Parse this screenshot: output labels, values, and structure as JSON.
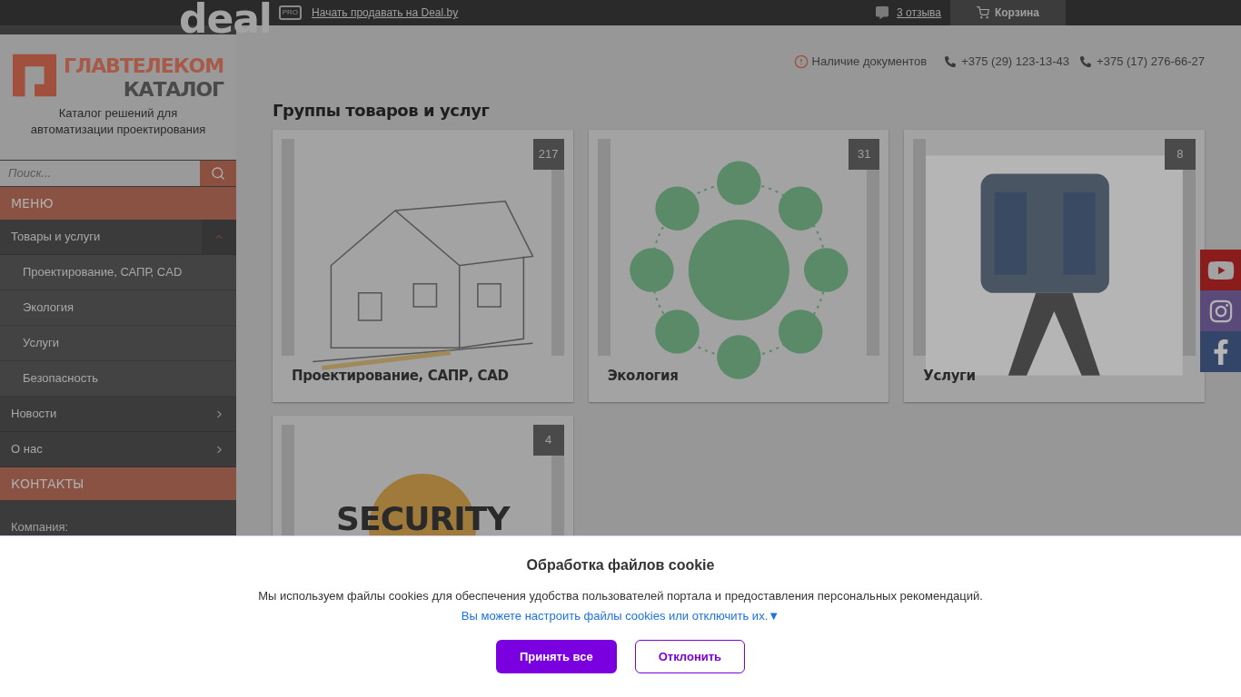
{
  "topbar": {
    "logo": "deal",
    "badge": "PRO",
    "sell_link": "Начать продавать на Deal.by",
    "reviews": "3 отзыва",
    "cart": "Корзина"
  },
  "sidebar": {
    "brand": "ГЛАВТЕЛЕКОМ",
    "brand_sub": "КАТАЛОГ",
    "tagline": "Каталог решений для автоматизации проектирования",
    "search": {
      "placeholder": "Поиск..."
    },
    "menu_title": "МЕНЮ",
    "menu": [
      {
        "label": "Товары и услуги",
        "expanded": true,
        "children": [
          {
            "label": "Проектирование, САПР, CAD"
          },
          {
            "label": "Экология"
          },
          {
            "label": "Услуги"
          },
          {
            "label": "Безопасность"
          }
        ]
      },
      {
        "label": "Новости",
        "expanded": false
      },
      {
        "label": "О нас",
        "expanded": false
      }
    ],
    "contacts_title": "КОНТАКТЫ",
    "contacts": [
      "Компания:"
    ]
  },
  "header_info": [
    {
      "kind": "warning",
      "text": "Наличие документов"
    },
    {
      "kind": "phone",
      "text": "+375 (29) 123-13-43"
    },
    {
      "kind": "phone",
      "text": "+375 (17) 276-66-27"
    }
  ],
  "section_title": "Группы товаров и услуг",
  "cards": [
    {
      "title": "Проектирование, САПР, CAD",
      "count": "217"
    },
    {
      "title": "Экология",
      "count": "31"
    },
    {
      "title": "Услуги",
      "count": "8"
    },
    {
      "count": "4",
      "image_text": "SECURITY"
    }
  ],
  "cookie": {
    "title": "Обработка файлов cookie",
    "text": "Мы используем файлы cookies для обеспечения удобства пользователей портала и предоставления персональных рекомендаций.",
    "settings_link": "Вы можете настроить файлы cookies или отключить их.▼",
    "buttons": [
      {
        "label": "Принять все",
        "kind": "primary"
      },
      {
        "label": "Отклонить",
        "kind": "secondary"
      }
    ]
  }
}
